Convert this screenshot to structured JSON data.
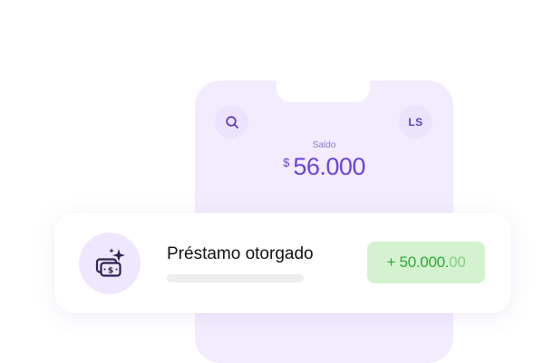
{
  "balance": {
    "label": "Saldo",
    "currency": "$",
    "amount": "56.000"
  },
  "header": {
    "search_icon": "search-icon",
    "avatar_initials": "LS"
  },
  "transaction": {
    "icon": "money-sparkles-icon",
    "title": "Préstamo otorgado",
    "amount_main": "+ 50.000.",
    "amount_decimals": "00"
  },
  "colors": {
    "phone_bg": "#f3ecfe",
    "accent": "#6b45d6",
    "positive": "#2fa637",
    "positive_bg": "#d4f2d0"
  }
}
